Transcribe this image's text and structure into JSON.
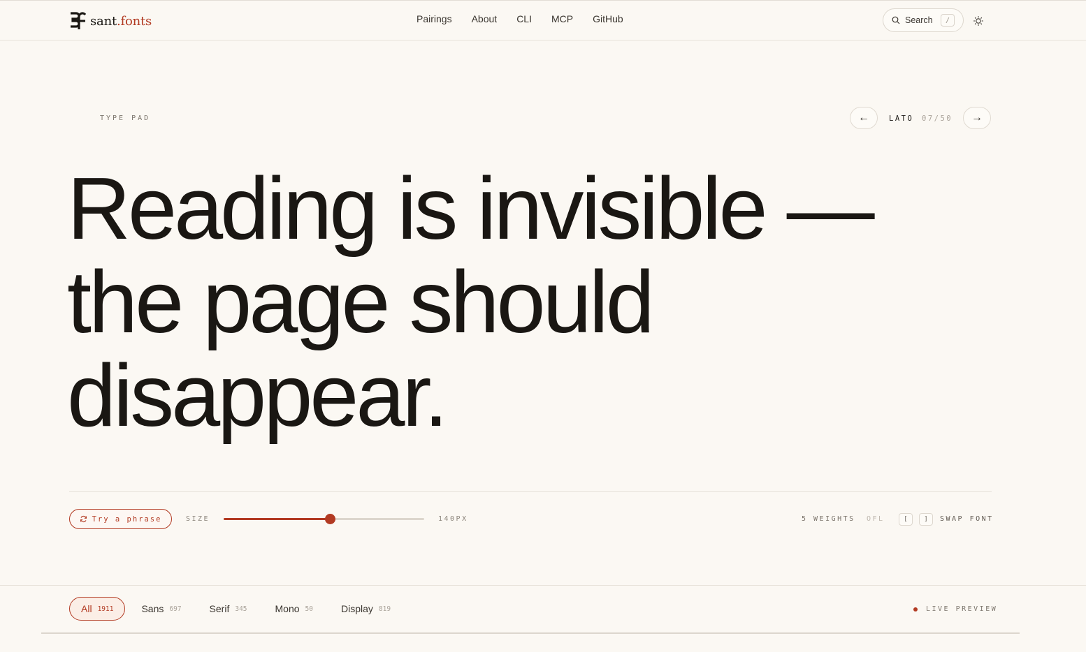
{
  "brand": {
    "name": "sant",
    "dot_suffix": ".fonts",
    "accent": "#b23a22"
  },
  "nav": {
    "items": [
      "Pairings",
      "About",
      "CLI",
      "MCP",
      "GitHub"
    ]
  },
  "search": {
    "label": "Search",
    "shortcut": "/"
  },
  "typepad": {
    "eyebrow": "TYPE PAD",
    "font_name": "LATO",
    "font_position": "07/50",
    "prev_arrow": "←",
    "next_arrow": "→",
    "specimen": "Reading is invisible — the page should disappear."
  },
  "controls": {
    "try_phrase": "Try a phrase",
    "size_label": "SIZE",
    "size_value": "140PX",
    "size_fraction": 0.53,
    "weights": "5 WEIGHTS",
    "license": "OFL",
    "key_prev": "[",
    "key_next": "]",
    "swap_label": "SWAP FONT"
  },
  "filters": {
    "items": [
      {
        "label": "All",
        "count": "1911",
        "active": true
      },
      {
        "label": "Sans",
        "count": "697",
        "active": false
      },
      {
        "label": "Serif",
        "count": "345",
        "active": false
      },
      {
        "label": "Mono",
        "count": "50",
        "active": false
      },
      {
        "label": "Display",
        "count": "819",
        "active": false
      }
    ],
    "live_preview": "LIVE PREVIEW"
  }
}
